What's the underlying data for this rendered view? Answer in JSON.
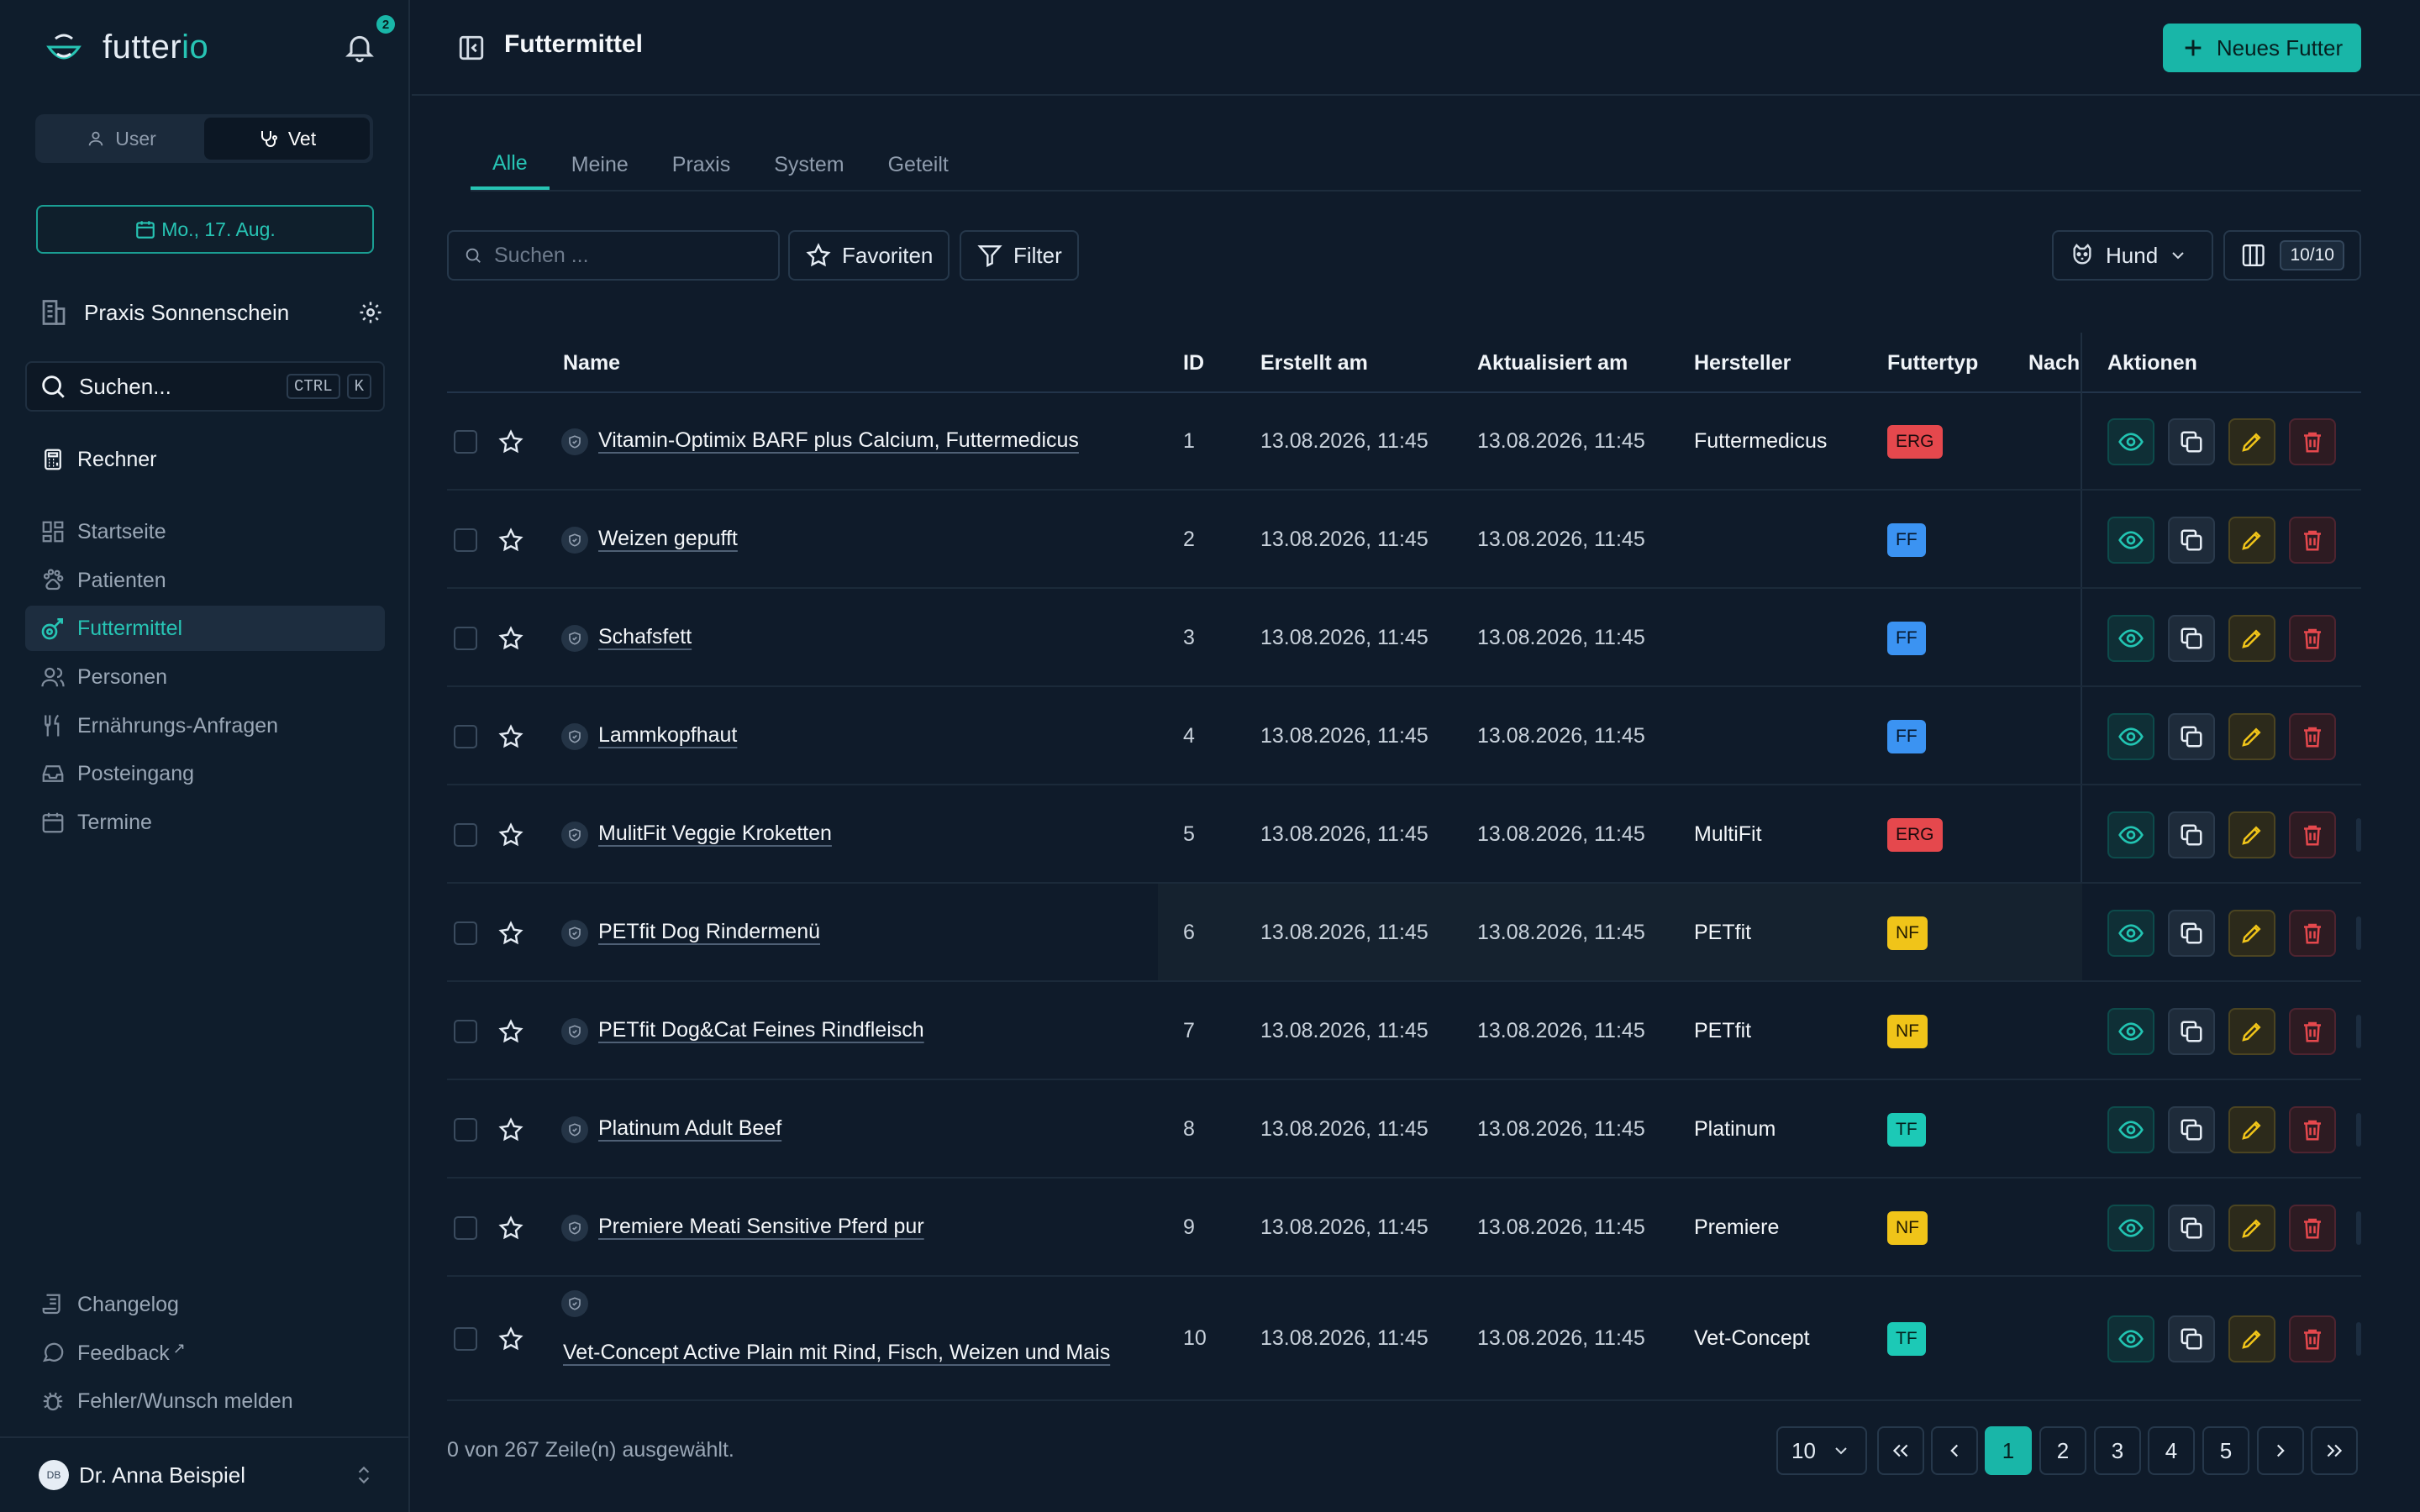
{
  "app": {
    "logo_main": "futter",
    "logo_accent": "io",
    "notification_count": "2"
  },
  "sidebar": {
    "role_user": "User",
    "role_vet": "Vet",
    "date": "Mo., 17. Aug.",
    "practice": "Praxis Sonnenschein",
    "search_label": "Suchen...",
    "search_kbd1": "CTRL",
    "search_kbd2": "K",
    "rechner": "Rechner",
    "nav": [
      {
        "label": "Startseite",
        "icon": "dashboard-icon"
      },
      {
        "label": "Patienten",
        "icon": "paw-icon"
      },
      {
        "label": "Futtermittel",
        "icon": "food-icon"
      },
      {
        "label": "Personen",
        "icon": "people-icon"
      },
      {
        "label": "Ernährungs-Anfragen",
        "icon": "utensils-icon"
      },
      {
        "label": "Posteingang",
        "icon": "inbox-icon"
      },
      {
        "label": "Termine",
        "icon": "calendar-icon"
      }
    ],
    "bottom": [
      {
        "label": "Changelog",
        "icon": "scroll-icon"
      },
      {
        "label": "Feedback",
        "icon": "chat-icon"
      },
      {
        "label": "Fehler/Wunsch melden",
        "icon": "bug-icon"
      }
    ],
    "user_initials": "DB",
    "user_name": "Dr. Anna Beispiel"
  },
  "header": {
    "title": "Futtermittel",
    "new_button": "Neues Futter"
  },
  "tabs": [
    "Alle",
    "Meine",
    "Praxis",
    "System",
    "Geteilt"
  ],
  "toolbar": {
    "search_placeholder": "Suchen ...",
    "favorites": "Favoriten",
    "filter": "Filter",
    "species": "Hund",
    "columns": "10/10"
  },
  "table": {
    "headers": {
      "name": "Name",
      "id": "ID",
      "created": "Erstellt am",
      "updated": "Aktualisiert am",
      "maker": "Hersteller",
      "type": "Futtertyp",
      "nach": "Nach",
      "actions": "Aktionen"
    },
    "rows": [
      {
        "name": "Vitamin-Optimix BARF plus Calcium, Futtermedicus",
        "id": "1",
        "created": "13.08.2026, 11:45",
        "updated": "13.08.2026, 11:45",
        "maker": "Futtermedicus",
        "type": "ERG"
      },
      {
        "name": "Weizen gepufft",
        "id": "2",
        "created": "13.08.2026, 11:45",
        "updated": "13.08.2026, 11:45",
        "maker": "",
        "type": "FF"
      },
      {
        "name": "Schafsfett",
        "id": "3",
        "created": "13.08.2026, 11:45",
        "updated": "13.08.2026, 11:45",
        "maker": "",
        "type": "FF"
      },
      {
        "name": "Lammkopfhaut",
        "id": "4",
        "created": "13.08.2026, 11:45",
        "updated": "13.08.2026, 11:45",
        "maker": "",
        "type": "FF"
      },
      {
        "name": "MulitFit Veggie Kroketten",
        "id": "5",
        "created": "13.08.2026, 11:45",
        "updated": "13.08.2026, 11:45",
        "maker": "MultiFit",
        "type": "ERG"
      },
      {
        "name": "PETfit Dog Rindermenü",
        "id": "6",
        "created": "13.08.2026, 11:45",
        "updated": "13.08.2026, 11:45",
        "maker": "PETfit",
        "type": "NF"
      },
      {
        "name": "PETfit Dog&Cat Feines Rindfleisch",
        "id": "7",
        "created": "13.08.2026, 11:45",
        "updated": "13.08.2026, 11:45",
        "maker": "PETfit",
        "type": "NF"
      },
      {
        "name": "Platinum Adult Beef",
        "id": "8",
        "created": "13.08.2026, 11:45",
        "updated": "13.08.2026, 11:45",
        "maker": "Platinum",
        "type": "TF"
      },
      {
        "name": "Premiere Meati Sensitive Pferd pur",
        "id": "9",
        "created": "13.08.2026, 11:45",
        "updated": "13.08.2026, 11:45",
        "maker": "Premiere",
        "type": "NF"
      },
      {
        "name": "Vet-Concept Active Plain mit Rind, Fisch, Weizen und Mais",
        "id": "10",
        "created": "13.08.2026, 11:45",
        "updated": "13.08.2026, 11:45",
        "maker": "Vet-Concept",
        "type": "TF"
      }
    ]
  },
  "type_colors": {
    "ERG": {
      "bg": "#e5484d",
      "fg": "#1a0b0d"
    },
    "FF": {
      "bg": "#3b93f2",
      "fg": "#061629"
    },
    "NF": {
      "bg": "#f0c419",
      "fg": "#231b02"
    },
    "TF": {
      "bg": "#1cc9b6",
      "fg": "#04201d"
    }
  },
  "footer": {
    "selection": "0 von 267 Zeile(n) ausgewählt.",
    "page_size": "10",
    "pages": [
      "1",
      "2",
      "3",
      "4",
      "5"
    ],
    "current_page": "1"
  },
  "colors": {
    "accent": "#19b6a8",
    "background": "#0f1b2a"
  }
}
